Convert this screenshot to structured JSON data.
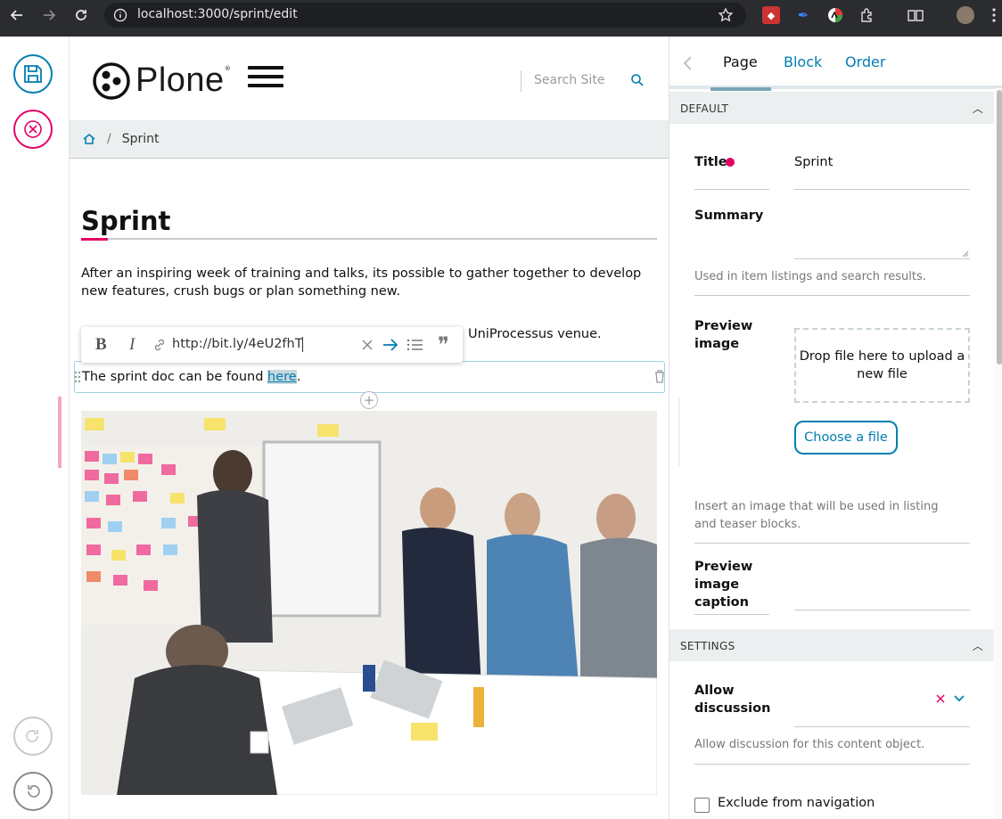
{
  "browser": {
    "url": "localhost:3000/sprint/edit"
  },
  "header": {
    "logo_text": "Plone",
    "search_placeholder": "Search Site"
  },
  "breadcrumb": {
    "current": "Sprint"
  },
  "document": {
    "title": "Sprint",
    "intro": "After an inspiring week of training and talks, its possible to gather together to develop new features, crush bugs or plan something new.",
    "para2_visible": "UniProcessus venue.",
    "para3_before": "The sprint doc can be found ",
    "para3_link": "here",
    "para3_after": ".",
    "link_input_value": "http://bit.ly/4eU2fhT"
  },
  "sidebar": {
    "tabs": [
      "Page",
      "Block",
      "Order"
    ],
    "sections": {
      "default": "DEFAULT",
      "settings": "SETTINGS"
    },
    "fields": {
      "title_label": "Title",
      "title_value": "Sprint",
      "summary_label": "Summary",
      "summary_help": "Used in item listings and search results.",
      "preview_image_label": "Preview image",
      "dropzone_text": "Drop file here to upload a new file",
      "choose_file": "Choose a file",
      "preview_image_help": "Insert an image that will be used in listing and teaser blocks.",
      "preview_caption_label": "Preview image caption",
      "allow_discussion_label": "Allow discussion",
      "allow_discussion_help": "Allow discussion for this content object.",
      "exclude_nav_label": "Exclude from navigation"
    }
  },
  "colors": {
    "brand_blue": "#007eb1",
    "accent_pink": "#e40166"
  }
}
